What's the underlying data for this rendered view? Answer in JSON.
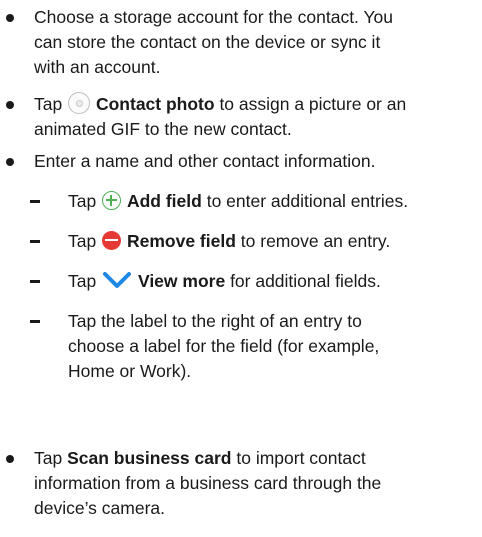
{
  "items": [
    {
      "lines": [
        "Choose a storage account for the contact. You",
        "can store the contact on the device or sync it",
        "with an account."
      ]
    },
    {
      "before": "Tap",
      "icon": "contact-photo-icon",
      "bold": "Contact photo",
      "line1_after": "to assign a picture or an",
      "line2": "animated GIF to the new contact."
    },
    {
      "lines": [
        "Enter a name and other contact information."
      ]
    }
  ],
  "sub_items": [
    {
      "before": "Tap",
      "icon": "add-icon",
      "bold": "Add field",
      "after": "to enter additional entries."
    },
    {
      "before": "Tap",
      "icon": "remove-icon",
      "bold": "Remove field",
      "after": "to remove an entry."
    },
    {
      "before": "Tap",
      "icon": "chevron-down-icon",
      "bold": "View more",
      "after": "for additional fields."
    },
    {
      "lines": [
        "Tap the label to the right of an entry to",
        "choose a label for the field (for example,",
        "Home or Work)."
      ]
    }
  ],
  "last_item": {
    "before": "Tap",
    "bold": "Scan business card",
    "line1_after": "to import contact",
    "line2": "information from a business card through the",
    "line3": "device’s camera."
  },
  "colors": {
    "text": "#1a1a1a",
    "add_green": "#4caf50",
    "remove_red": "#e53935",
    "chevron_blue": "#1e88e5",
    "photo_gray": "#bdbdbd"
  }
}
